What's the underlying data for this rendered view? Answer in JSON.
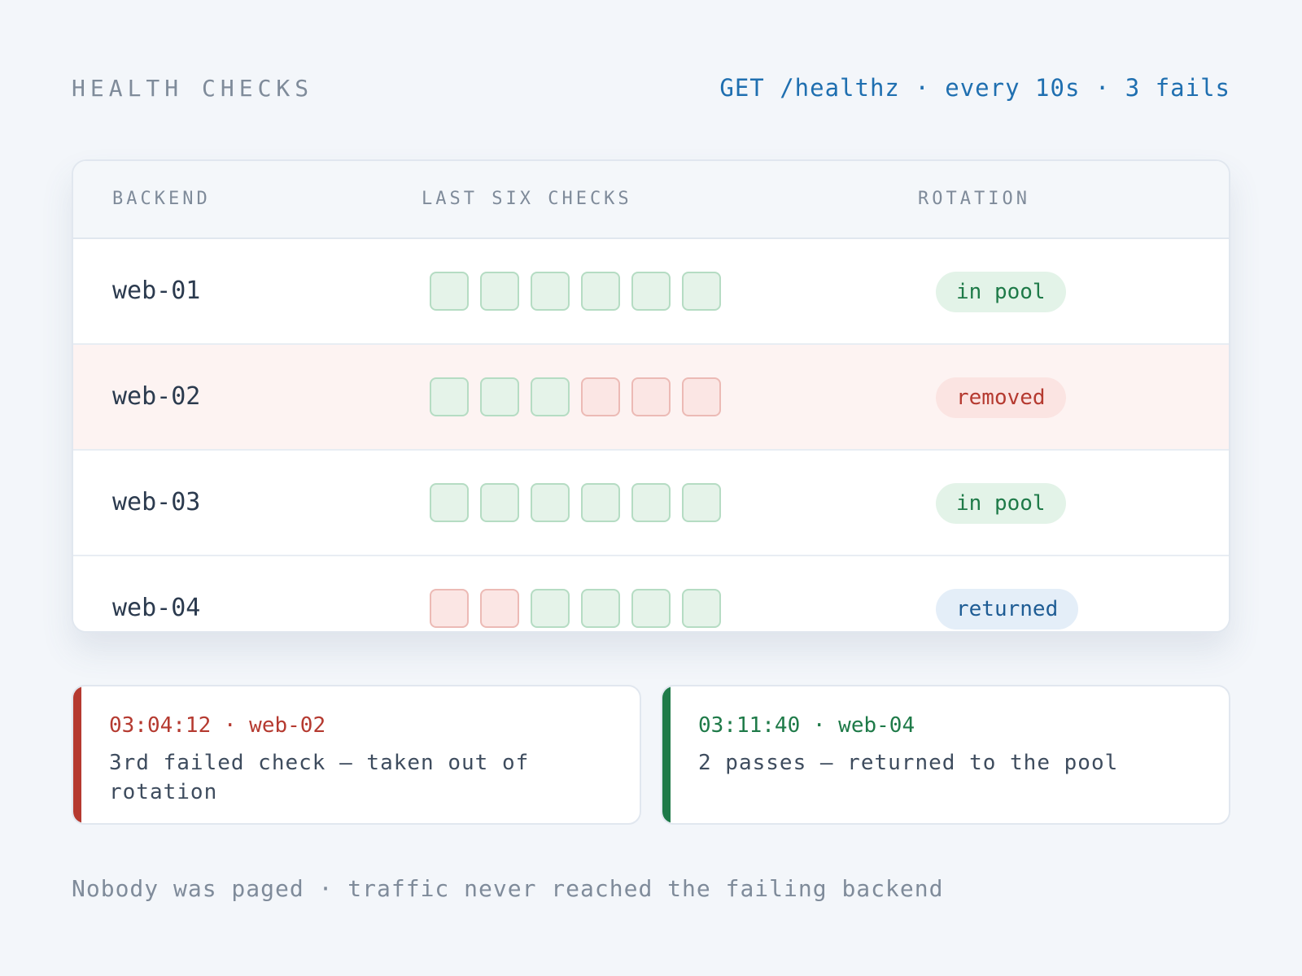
{
  "header": {
    "title": "HEALTH CHECKS",
    "probe": "GET /healthz · every 10s · 3 fails"
  },
  "table": {
    "columns": [
      "BACKEND",
      "LAST SIX CHECKS",
      "ROTATION"
    ],
    "rows": [
      {
        "backend": "web-01",
        "checks": [
          "pass",
          "pass",
          "pass",
          "pass",
          "pass",
          "pass"
        ],
        "rotation": "in pool"
      },
      {
        "backend": "web-02",
        "checks": [
          "pass",
          "pass",
          "pass",
          "fail",
          "fail",
          "fail"
        ],
        "rotation": "removed"
      },
      {
        "backend": "web-03",
        "checks": [
          "pass",
          "pass",
          "pass",
          "pass",
          "pass",
          "pass"
        ],
        "rotation": "in pool"
      },
      {
        "backend": "web-04",
        "checks": [
          "fail",
          "fail",
          "pass",
          "pass",
          "pass",
          "pass"
        ],
        "rotation": "returned"
      }
    ]
  },
  "events": [
    {
      "time": "03:04:12 · web-02",
      "text": "3rd failed check — taken out of rotation",
      "status": "red"
    },
    {
      "time": "03:11:40 · web-04",
      "text": "2 passes — returned to the pool",
      "status": "green"
    }
  ],
  "footnote": "Nobody was paged · traffic never reached the failing backend",
  "colors": {
    "pass": "#e5f3e9",
    "fail": "#fbe6e4",
    "accent": "#1f6fb0",
    "red": "#b53a30",
    "green": "#1e7a48"
  }
}
